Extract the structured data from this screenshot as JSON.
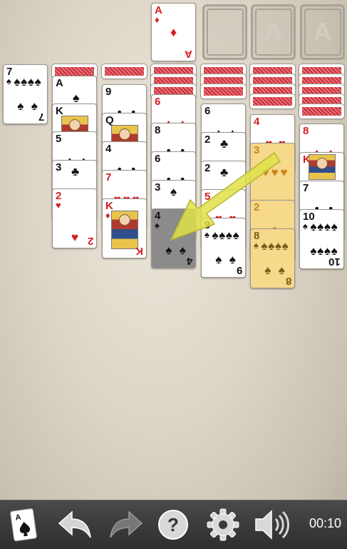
{
  "foundations": [
    {
      "label": "A"
    },
    {
      "label": "A"
    },
    {
      "label": "A"
    }
  ],
  "foundation_top": {
    "rank": "A",
    "suit": "♦"
  },
  "stock_top": {
    "rank": "7",
    "suit": "♠"
  },
  "columns": {
    "c1": [
      {
        "rank": "A",
        "suit": "♠"
      },
      {
        "rank": "K",
        "suit": "♣"
      },
      {
        "rank": "5",
        "suit": "♠"
      },
      {
        "rank": "3",
        "suit": "♣"
      },
      {
        "rank": "2",
        "suit": "♥"
      }
    ],
    "c2": [
      {
        "rank": "9",
        "suit": "♣"
      },
      {
        "rank": "Q",
        "suit": "♣"
      },
      {
        "rank": "4",
        "suit": "♣"
      },
      {
        "rank": "7",
        "suit": "♥"
      },
      {
        "rank": "K",
        "suit": "♦"
      }
    ],
    "c3": [
      {
        "rank": "6",
        "suit": "♦"
      },
      {
        "rank": "8",
        "suit": "♣"
      },
      {
        "rank": "6",
        "suit": "♣"
      },
      {
        "rank": "3",
        "suit": "♠"
      },
      {
        "rank": "4",
        "suit": "♠"
      }
    ],
    "c4": [
      {
        "rank": "6",
        "suit": "♠"
      },
      {
        "rank": "2",
        "suit": "♣"
      },
      {
        "rank": "2",
        "suit": "♣"
      },
      {
        "rank": "5",
        "suit": "♥"
      },
      {
        "rank": "9",
        "suit": "♠"
      }
    ],
    "c5": [
      {
        "rank": "4",
        "suit": "♥"
      },
      {
        "rank": "3",
        "suit": "♥"
      },
      {
        "rank": "2",
        "suit": "♦"
      },
      {
        "rank": "8",
        "suit": "♠"
      }
    ],
    "c6": [
      {
        "rank": "8",
        "suit": "♦"
      },
      {
        "rank": "K",
        "suit": "♦"
      },
      {
        "rank": "7",
        "suit": "♣"
      },
      {
        "rank": "10",
        "suit": "♠"
      }
    ]
  },
  "toolbar": {
    "timer": "00:10"
  },
  "colors": {
    "red": "#d71c22",
    "black": "#111111",
    "highlight": "#f6d98a",
    "arrow": "#dfe04a"
  }
}
